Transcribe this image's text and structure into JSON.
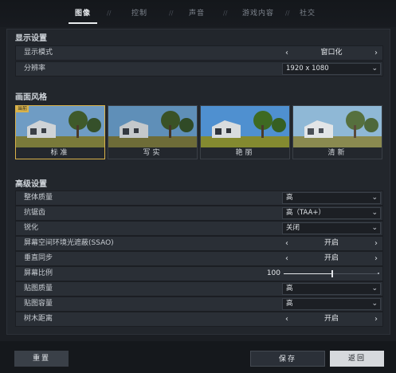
{
  "tabs": [
    {
      "label": "图像",
      "active": true
    },
    {
      "label": "控制"
    },
    {
      "label": "声音"
    },
    {
      "label": "游戏内容"
    },
    {
      "label": "社交"
    }
  ],
  "display": {
    "title": "显示设置",
    "mode_label": "显示模式",
    "mode_value": "窗口化",
    "resolution_label": "分辨率",
    "resolution_value": "1920 x 1080"
  },
  "style": {
    "title": "画面风格",
    "badge": "当前",
    "cards": [
      "标准",
      "写实",
      "艳丽",
      "清新"
    ]
  },
  "advanced": {
    "title": "高级设置",
    "rows": [
      {
        "label": "整体质量",
        "type": "drop",
        "value": "高"
      },
      {
        "label": "抗锯齿",
        "type": "drop",
        "value": "高（TAA+）"
      },
      {
        "label": "锐化",
        "type": "drop",
        "value": "关闭"
      },
      {
        "label": "屏幕空间环境光遮蔽(SSAO)",
        "type": "arrow",
        "value": "开启"
      },
      {
        "label": "垂直同步",
        "type": "arrow",
        "value": "开启"
      },
      {
        "label": "屏幕比例",
        "type": "slider",
        "value": "100",
        "fraction": 0.5
      },
      {
        "label": "贴图质量",
        "type": "drop",
        "value": "高"
      },
      {
        "label": "贴图容量",
        "type": "drop",
        "value": "高"
      },
      {
        "label": "树木距离",
        "type": "arrow",
        "value": "开启"
      }
    ]
  },
  "buttons": {
    "reset": "重置",
    "save": "保存",
    "back": "返回"
  },
  "colors": {
    "accent_gold": "#d9b24a",
    "panel_bg": "#22262c"
  }
}
